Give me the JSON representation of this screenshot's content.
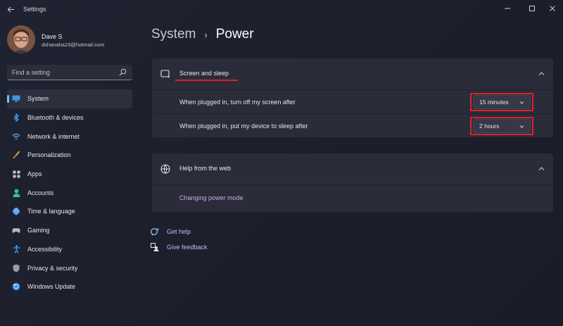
{
  "window": {
    "title": "Settings",
    "back_icon": "arrow-left-icon",
    "controls": [
      "minimize-icon",
      "maximize-icon",
      "close-icon"
    ]
  },
  "profile": {
    "name": "Dave S",
    "email": "dshanaha23@hotmail.com"
  },
  "search": {
    "placeholder": "Find a setting",
    "value": ""
  },
  "sidebar": {
    "items": [
      {
        "label": "System",
        "icon": "display-icon",
        "active": true
      },
      {
        "label": "Bluetooth & devices",
        "icon": "bluetooth-icon"
      },
      {
        "label": "Network & internet",
        "icon": "wifi-icon"
      },
      {
        "label": "Personalization",
        "icon": "brush-icon"
      },
      {
        "label": "Apps",
        "icon": "apps-icon"
      },
      {
        "label": "Accounts",
        "icon": "person-icon"
      },
      {
        "label": "Time & language",
        "icon": "globe-clock-icon"
      },
      {
        "label": "Gaming",
        "icon": "gamepad-icon"
      },
      {
        "label": "Accessibility",
        "icon": "accessibility-icon"
      },
      {
        "label": "Privacy & security",
        "icon": "shield-icon"
      },
      {
        "label": "Windows Update",
        "icon": "update-icon"
      }
    ]
  },
  "breadcrumb": {
    "parent": "System",
    "separator": "›",
    "current": "Power"
  },
  "screen_sleep": {
    "title": "Screen and sleep",
    "icon": "screen-sleep-icon",
    "rows": [
      {
        "label": "When plugged in, turn off my screen after",
        "value": "15 minutes"
      },
      {
        "label": "When plugged in, put my device to sleep after",
        "value": "2 hours"
      }
    ]
  },
  "help_web": {
    "title": "Help from the web",
    "icon": "globe-icon",
    "link": "Changing power mode"
  },
  "footer": {
    "get_help": "Get help",
    "feedback": "Give feedback"
  },
  "colors": {
    "background": "#1d1f2c",
    "card": "#2a2c39",
    "accent": "#6cc4ff",
    "link": "#c9a8e8",
    "annotation_red": "#e0202a"
  }
}
